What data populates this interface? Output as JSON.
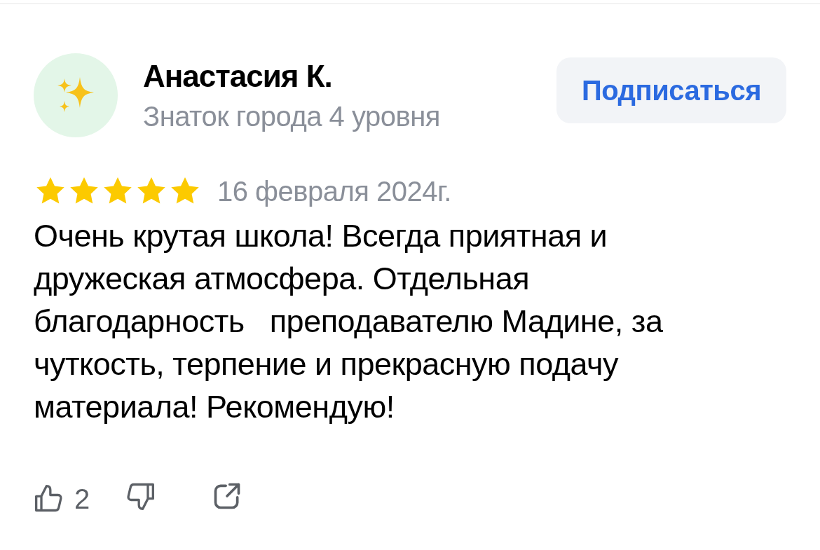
{
  "author": {
    "name": "Анастасия К.",
    "subtitle": "Знаток города 4 уровня"
  },
  "subscribe_button": "Подписаться",
  "rating": {
    "stars": 5
  },
  "date": "16 февраля 2024г.",
  "review_text": "Очень крутая школа! Всегда приятная и дружеская атмосфера. Отдельная благодарность   преподавателю Мадине, за чуткость, терпение и прекрасную подачу материала! Рекомендую!",
  "actions": {
    "likes": "2"
  }
}
